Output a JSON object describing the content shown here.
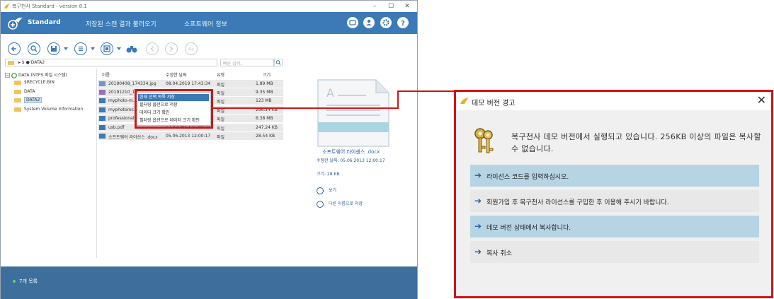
{
  "app": {
    "window_title": "복구천사 Standard - version 8.1",
    "brand": "Standard",
    "menu": [
      "저장된 스캔 결과 불러오기",
      "소프트웨어 정보"
    ],
    "search_placeholder": "빠른 검색..",
    "breadcrumb": "▸ $ ● DATA2",
    "accent_color": "#3b79b7",
    "highlight_color": "#d21414"
  },
  "tree": {
    "root": "DATA (NTFS 파일 시스템)",
    "items": [
      "$RECYCLE.BIN",
      "DATA",
      "DATA2",
      "System Volume Information"
    ],
    "selected": "DATA2"
  },
  "file_list": {
    "columns": [
      "이름",
      "수정한 날짜",
      "유형",
      "크기"
    ],
    "rows": [
      {
        "name": "20190408_174334.jpg",
        "date": "08.04.2019 17:43:34",
        "type": "파일",
        "size": "1.89 MB"
      },
      {
        "name": "20191210_10...",
        "date": "",
        "type": "파일",
        "size": "9.35 MB"
      },
      {
        "name": "myphoto-m...",
        "date": "",
        "type": "파일",
        "size": "123 MB"
      },
      {
        "name": "myphotorec...",
        "date": "",
        "type": "파일",
        "size": "296.14 KB"
      },
      {
        "name": "professional...",
        "date": "",
        "type": "파일",
        "size": "6.38 MB"
      },
      {
        "name": "usb.pdf",
        "date": "17.07.2017 15:00:31",
        "type": "파일",
        "size": "247.24 KB"
      },
      {
        "name": "소프트웨어 라이선스 .docx",
        "date": "05.06.2013 12:00:17",
        "type": "파일",
        "size": "28.54 KB"
      }
    ]
  },
  "context_menu": {
    "items": [
      "현재 선택 목록 저장",
      "필터링 옵션으로 저장",
      "데이터 크기 확인",
      "필터링 옵션으로 데이터 크기 확인"
    ],
    "highlighted_index": 0
  },
  "preview": {
    "file_name": "소프트웨어 라이센스 .docx",
    "modified": "수정한 날짜: 05.06.2013 12:00:17",
    "size": "크기: 28 KB",
    "view_label": "보기",
    "save_as_label": "다른 이름으로 저장"
  },
  "status": {
    "text": "7개 목록"
  },
  "dialog": {
    "title": "데모 버전 경고",
    "message": "복구천사 데모 버전에서 실행되고 있습니다. 256KB 이상의 파일은 복사할 수 없습니다.",
    "options": [
      {
        "label": "라이선스 코드를 입력하십시오.",
        "highlighted": true
      },
      {
        "label": "회원가입 후 복구천사 라이선스를 구입한 후 이용해 주시기 바랍니다.",
        "highlighted": false
      },
      {
        "label": "데모 버전 상태에서 복사합니다.",
        "highlighted": true
      },
      {
        "label": "복사 취소",
        "highlighted": false
      }
    ],
    "close_glyph": "✕",
    "arrow_glyph": "➔"
  }
}
